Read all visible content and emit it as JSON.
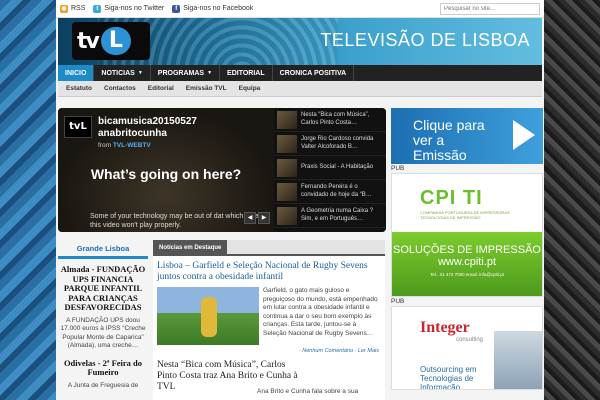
{
  "topbar": {
    "rss": "RSS",
    "twitter": "Siga-nos no Twitter",
    "facebook": "Siga-nos no Facebook",
    "search_placeholder": "Pesquisar no site..."
  },
  "header": {
    "logo_text_1": "tv",
    "logo_text_2": "L",
    "site_title": "TELEVISÃO DE LISBOA"
  },
  "nav": {
    "items": [
      {
        "label": "INICIO",
        "active": true,
        "dropdown": false
      },
      {
        "label": "NOTICIAS",
        "active": false,
        "dropdown": true
      },
      {
        "label": "PROGRAMAS",
        "active": false,
        "dropdown": true
      },
      {
        "label": "EDITORIAL",
        "active": false,
        "dropdown": false
      },
      {
        "label": "CRONICA POSITIVA",
        "active": false,
        "dropdown": false
      }
    ]
  },
  "subnav": {
    "items": [
      "Estatuto",
      "Contactos",
      "Editorial",
      "Emissão TVL",
      "Equipa"
    ]
  },
  "video": {
    "logo": "tvL",
    "title": "bicamusica20150527 anabritocunha",
    "from_prefix": "from",
    "from_channel": "TVL-WEBTV",
    "question": "What’s going on here?",
    "note": "Some of your technology may be out of dat which means this video won't play properly.",
    "prev": "◀",
    "next": "▶",
    "playlist": [
      "Nesta “Bica com Música”, Carlos Pinto Costa…",
      "Jorge Rio Cardoso convida Valter Alcoforado B…",
      "Praxis Social - A Habitação",
      "Fernando Pereira é o convidado de hoje da “B…",
      "A Geometria numa Caixa ? Sim, e em Português…"
    ]
  },
  "sidebar": {
    "ad1_text": "Clique para ver a Emissão",
    "pub1": "PUB",
    "cpi_logo": "CPI TI",
    "cpi_sub": "COMPANHIA PORTUGUESA DE IMPRESSORAS TECNOLOGIAS DE IMPRESSÃO",
    "cpi_line1": "SOLUÇÕES DE IMPRESSÃO",
    "cpi_line2": "www.cpiti.pt",
    "cpi_contact": "Tel.: 21 472 7000   email: info@cpiti.pt",
    "pub2": "PUB",
    "integer_brand": "Integer",
    "integer_sub": "consulting",
    "integer_text": "Outsourcing em Tecnologias de Informação"
  },
  "left_column": {
    "heading": "Grande Lisboa",
    "article1_title": "Almada - FUNDAÇÃO UPS FINANCIA PARQUE INFANTIL PARA CRIANÇAS DESFAVORECIDAS",
    "article1_excerpt": "A FUNDAÇÃO UPS doou 17.000 euros à IPSS “Creche Popular Monte de Caparica” (Almada), uma creche…",
    "article2_title": "Odivelas - 2ª Feira do Fumeiro",
    "article2_excerpt": "A Junta de Freguesia de"
  },
  "featured": {
    "tab": "Notícias em Destaque",
    "article1_title": "Lisboa – Garfield e Seleção Nacional de Rugby Sevens juntos contra a obesidade infantil",
    "article1_excerpt": "Garfield, o gato mais guloso e preguiçoso do mundo, está empenhado em lutar contra a obesidade infantil e continua a dar o seu bom exemplo às crianças. Esta tarde, juntou-se à Seleção Nacional de Rugby Sevens…",
    "article1_meta": "· Nenhum Comentário · Ler Mais",
    "article2_title": "Nesta “Bica com Música”, Carlos Pinto Costa traz Ana Brito e Cunha à TVL",
    "article2_excerpt": "Ana Brito e Cunha fala sobre a sua"
  }
}
